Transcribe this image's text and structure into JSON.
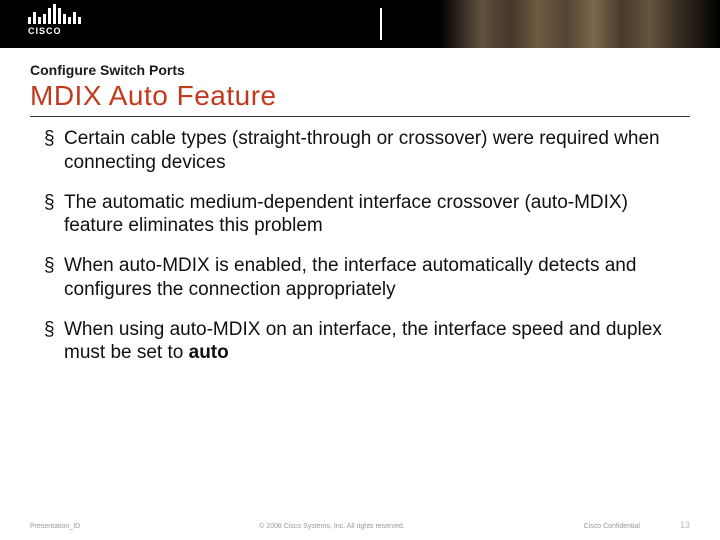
{
  "header": {
    "logo_text": "CISCO"
  },
  "slide": {
    "subtitle": "Configure Switch Ports",
    "title": "MDIX Auto Feature",
    "bullets": [
      {
        "text": "Certain cable types (straight-through or crossover) were required when connecting devices"
      },
      {
        "text": "The automatic medium-dependent interface crossover (auto-MDIX) feature eliminates this problem"
      },
      {
        "text": "When auto-MDIX is enabled, the interface automatically detects and configures the connection appropriately"
      },
      {
        "text_prefix": "When using auto-MDIX on an interface, the interface speed and duplex must be set to ",
        "bold": "auto"
      }
    ]
  },
  "footer": {
    "left": "Presentation_ID",
    "center": "© 2008 Cisco Systems, Inc. All rights reserved.",
    "confidential": "Cisco Confidential",
    "page": "13"
  }
}
